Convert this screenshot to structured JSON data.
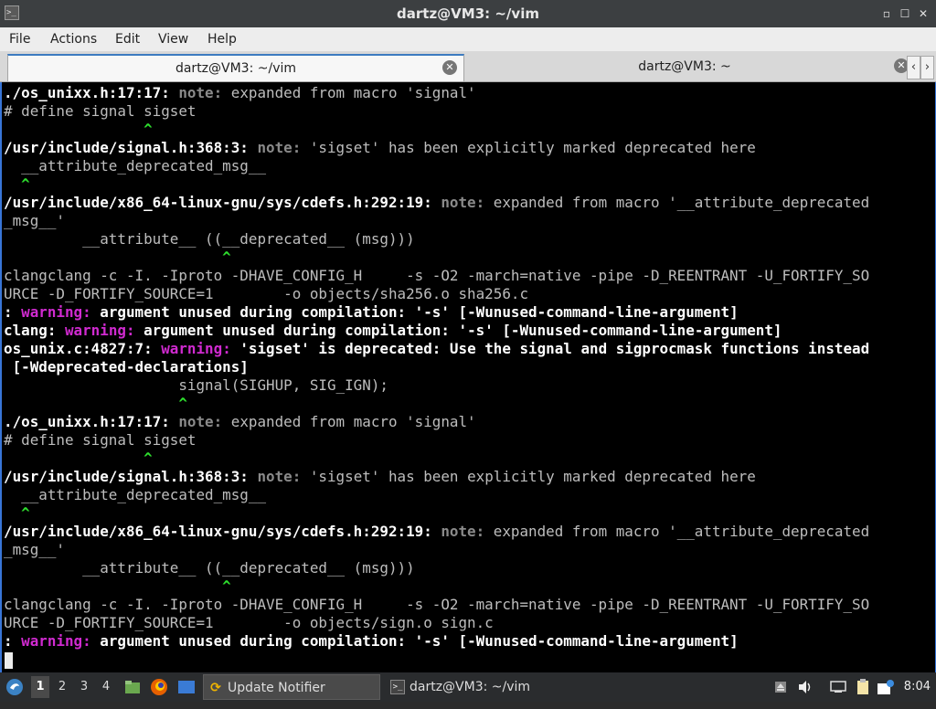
{
  "window": {
    "title": "dartz@VM3: ~/vim",
    "icon": "terminal-icon",
    "buttons": {
      "minimize": "▫",
      "maximize": "☐",
      "close": "✕"
    }
  },
  "menubar": {
    "items": [
      {
        "label": "File"
      },
      {
        "label": "Actions"
      },
      {
        "label": "Edit"
      },
      {
        "label": "View"
      },
      {
        "label": "Help"
      }
    ]
  },
  "tabs": [
    {
      "label": "dartz@VM3: ~/vim",
      "active": true
    },
    {
      "label": "dartz@VM3: ~",
      "active": false
    }
  ],
  "tab_scroll": {
    "left": "‹",
    "right": "›"
  },
  "terminal": {
    "colors": {
      "background": "#000000",
      "text": "#bdbdbd",
      "note": "#8a8a8a",
      "warning": "#d02ad0",
      "caret": "#2ee02e"
    },
    "lines": [
      [
        {
          "t": "./os_unixx.h:17:17: ",
          "c": "b"
        },
        {
          "t": "note: ",
          "c": "n"
        },
        {
          "t": "expanded from macro 'signal'",
          "c": ""
        }
      ],
      [
        {
          "t": "# define signal sigset",
          "c": ""
        }
      ],
      [
        {
          "t": "                ^",
          "c": "g"
        }
      ],
      [
        {
          "t": "/usr/include/signal.h:368:3: ",
          "c": "b"
        },
        {
          "t": "note: ",
          "c": "n"
        },
        {
          "t": "'sigset' has been explicitly marked deprecated here",
          "c": ""
        }
      ],
      [
        {
          "t": "  __attribute_deprecated_msg__",
          "c": ""
        }
      ],
      [
        {
          "t": "  ^",
          "c": "g"
        }
      ],
      [
        {
          "t": "/usr/include/x86_64-linux-gnu/sys/cdefs.h:292:19: ",
          "c": "b"
        },
        {
          "t": "note: ",
          "c": "n"
        },
        {
          "t": "expanded from macro '__attribute_deprecated",
          "c": ""
        }
      ],
      [
        {
          "t": "_msg__'",
          "c": ""
        }
      ],
      [
        {
          "t": "         __attribute__ ((__deprecated__ (msg)))",
          "c": ""
        }
      ],
      [
        {
          "t": "                         ^",
          "c": "g"
        }
      ],
      [
        {
          "t": "clangclang -c -I. -Iproto -DHAVE_CONFIG_H     -s -O2 -march=native -pipe -D_REENTRANT -U_FORTIFY_SO",
          "c": ""
        }
      ],
      [
        {
          "t": "URCE -D_FORTIFY_SOURCE=1        -o objects/sha256.o sha256.c",
          "c": ""
        }
      ],
      [
        {
          "t": ": ",
          "c": "b"
        },
        {
          "t": "warning: ",
          "c": "w"
        },
        {
          "t": "argument unused during compilation: '-s' [-Wunused-command-line-argument]",
          "c": "b"
        }
      ],
      [
        {
          "t": "clang: ",
          "c": "b"
        },
        {
          "t": "warning: ",
          "c": "w"
        },
        {
          "t": "argument unused during compilation: '-s' [-Wunused-command-line-argument]",
          "c": "b"
        }
      ],
      [
        {
          "t": "os_unix.c:4827:7: ",
          "c": "b"
        },
        {
          "t": "warning: ",
          "c": "w"
        },
        {
          "t": "'sigset' is deprecated: Use the signal and sigprocmask functions instead",
          "c": "b"
        }
      ],
      [
        {
          "t": " [-Wdeprecated-declarations]",
          "c": "b"
        }
      ],
      [
        {
          "t": "                    signal(SIGHUP, SIG_IGN);",
          "c": ""
        }
      ],
      [
        {
          "t": "                    ^",
          "c": "g"
        }
      ],
      [
        {
          "t": "./os_unixx.h:17:17: ",
          "c": "b"
        },
        {
          "t": "note: ",
          "c": "n"
        },
        {
          "t": "expanded from macro 'signal'",
          "c": ""
        }
      ],
      [
        {
          "t": "# define signal sigset",
          "c": ""
        }
      ],
      [
        {
          "t": "                ^",
          "c": "g"
        }
      ],
      [
        {
          "t": "/usr/include/signal.h:368:3: ",
          "c": "b"
        },
        {
          "t": "note: ",
          "c": "n"
        },
        {
          "t": "'sigset' has been explicitly marked deprecated here",
          "c": ""
        }
      ],
      [
        {
          "t": "  __attribute_deprecated_msg__",
          "c": ""
        }
      ],
      [
        {
          "t": "  ^",
          "c": "g"
        }
      ],
      [
        {
          "t": "/usr/include/x86_64-linux-gnu/sys/cdefs.h:292:19: ",
          "c": "b"
        },
        {
          "t": "note: ",
          "c": "n"
        },
        {
          "t": "expanded from macro '__attribute_deprecated",
          "c": ""
        }
      ],
      [
        {
          "t": "_msg__'",
          "c": ""
        }
      ],
      [
        {
          "t": "         __attribute__ ((__deprecated__ (msg)))",
          "c": ""
        }
      ],
      [
        {
          "t": "                         ^",
          "c": "g"
        }
      ],
      [
        {
          "t": "clangclang -c -I. -Iproto -DHAVE_CONFIG_H     -s -O2 -march=native -pipe -D_REENTRANT -U_FORTIFY_SO",
          "c": ""
        }
      ],
      [
        {
          "t": "URCE -D_FORTIFY_SOURCE=1        -o objects/sign.o sign.c",
          "c": ""
        }
      ],
      [
        {
          "t": ": ",
          "c": "b"
        },
        {
          "t": "warning: ",
          "c": "w"
        },
        {
          "t": "argument unused during compilation: '-s' [-Wunused-command-line-argument]",
          "c": "b"
        }
      ]
    ]
  },
  "taskbar": {
    "menu_icon": "start-menu-icon",
    "workspaces": [
      "1",
      "2",
      "3",
      "4"
    ],
    "active_workspace": "1",
    "launchers": [
      "file-manager-icon",
      "firefox-icon",
      "show-desktop-icon"
    ],
    "tasks": [
      {
        "label": "Update Notifier",
        "icon": "update-icon",
        "active": true
      },
      {
        "label": "dartz@VM3: ~/vim",
        "icon": "terminal-icon",
        "active": false
      }
    ],
    "tray": [
      "eject-icon",
      "volume-icon",
      "network-icon",
      "clipboard-icon",
      "notification-icon"
    ],
    "clock": "8:04"
  }
}
